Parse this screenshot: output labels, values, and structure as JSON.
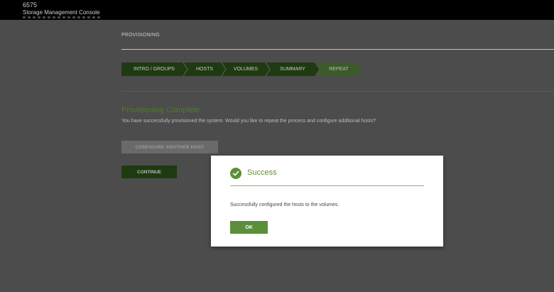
{
  "header": {
    "model": "6575",
    "app_title": "Storage Management Console"
  },
  "page": {
    "section_title": "PROVISIONING",
    "wizard_steps": [
      {
        "label": "INTRO / GROUPS"
      },
      {
        "label": "HOSTS"
      },
      {
        "label": "VOLUMES"
      },
      {
        "label": "SUMMARY"
      },
      {
        "label": "REPEAT"
      }
    ],
    "complete_title": "Provisioning Complete",
    "complete_text": "You have successfully provisioned the system. Would you like to repeat the process and configure additional hosts?",
    "configure_another_label": "CONFIGURE ANOTHER HOST",
    "continue_label": "CONTINUE"
  },
  "modal": {
    "icon": "check-circle-icon",
    "title": "Success",
    "message": "Successfully configured the hosts to the volumes.",
    "ok_label": "OK"
  },
  "colors": {
    "accent": "#5b8f3a",
    "step_dark": "#1e3a10",
    "overlay": "#4c4c4c"
  }
}
